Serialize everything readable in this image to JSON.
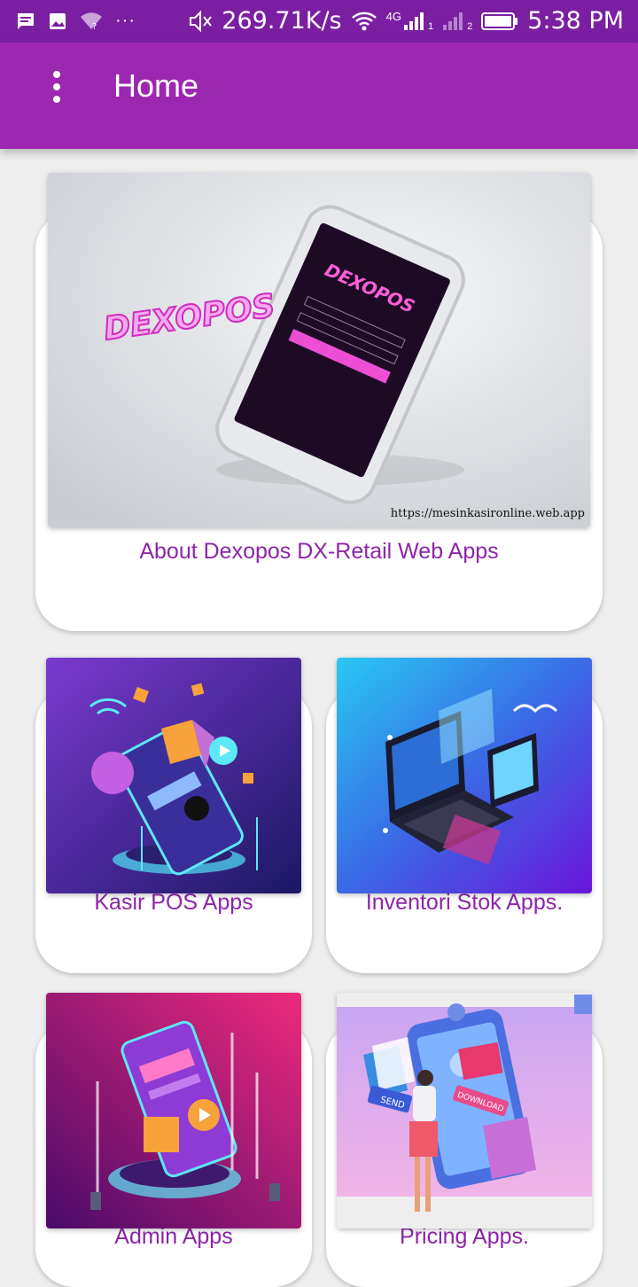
{
  "status_bar": {
    "speed": "269.71K/s",
    "network": "4G",
    "sim1": "1",
    "sim2": "2",
    "time": "5:38 PM"
  },
  "app_bar": {
    "title": "Home"
  },
  "cards": {
    "about": {
      "label": "About Dexopos DX-Retail Web Apps",
      "brand": "DEXOPOS",
      "url": "https://mesinkasironline.web.app"
    },
    "kasir": {
      "label": "Kasir POS Apps"
    },
    "inventori": {
      "label": "Inventori Stok Apps."
    },
    "admin": {
      "label": "Admin Apps"
    },
    "pricing": {
      "label": "Pricing Apps.",
      "send": "SEND",
      "download": "DOWNLOAD"
    }
  }
}
